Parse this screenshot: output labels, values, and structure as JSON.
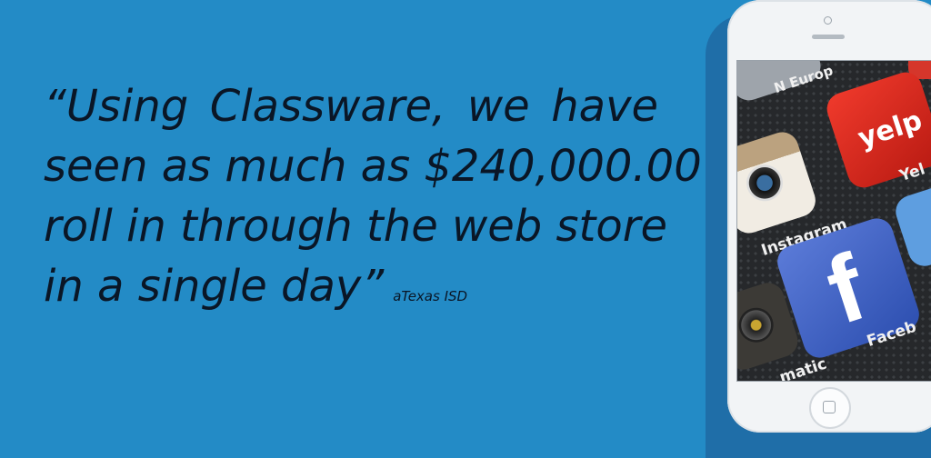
{
  "quote": {
    "lines": [
      "“Using Classware, we have",
      "seen as much as $240,000.00",
      "roll in through the web store",
      "in a single day”"
    ],
    "attribution": "aTexas ISD"
  },
  "phone": {
    "apps": [
      {
        "name": "yelp",
        "label": "yelp"
      },
      {
        "name": "instagram",
        "label": "Instagram"
      },
      {
        "name": "facebook",
        "label": "Faceb"
      }
    ],
    "screen_fragments": {
      "top": "N Europ",
      "yelp_side": "Yel",
      "camera_side": "matic"
    }
  },
  "colors": {
    "background": "#238bc6",
    "text": "#0a1626",
    "phone_body": "#f2f4f6"
  }
}
